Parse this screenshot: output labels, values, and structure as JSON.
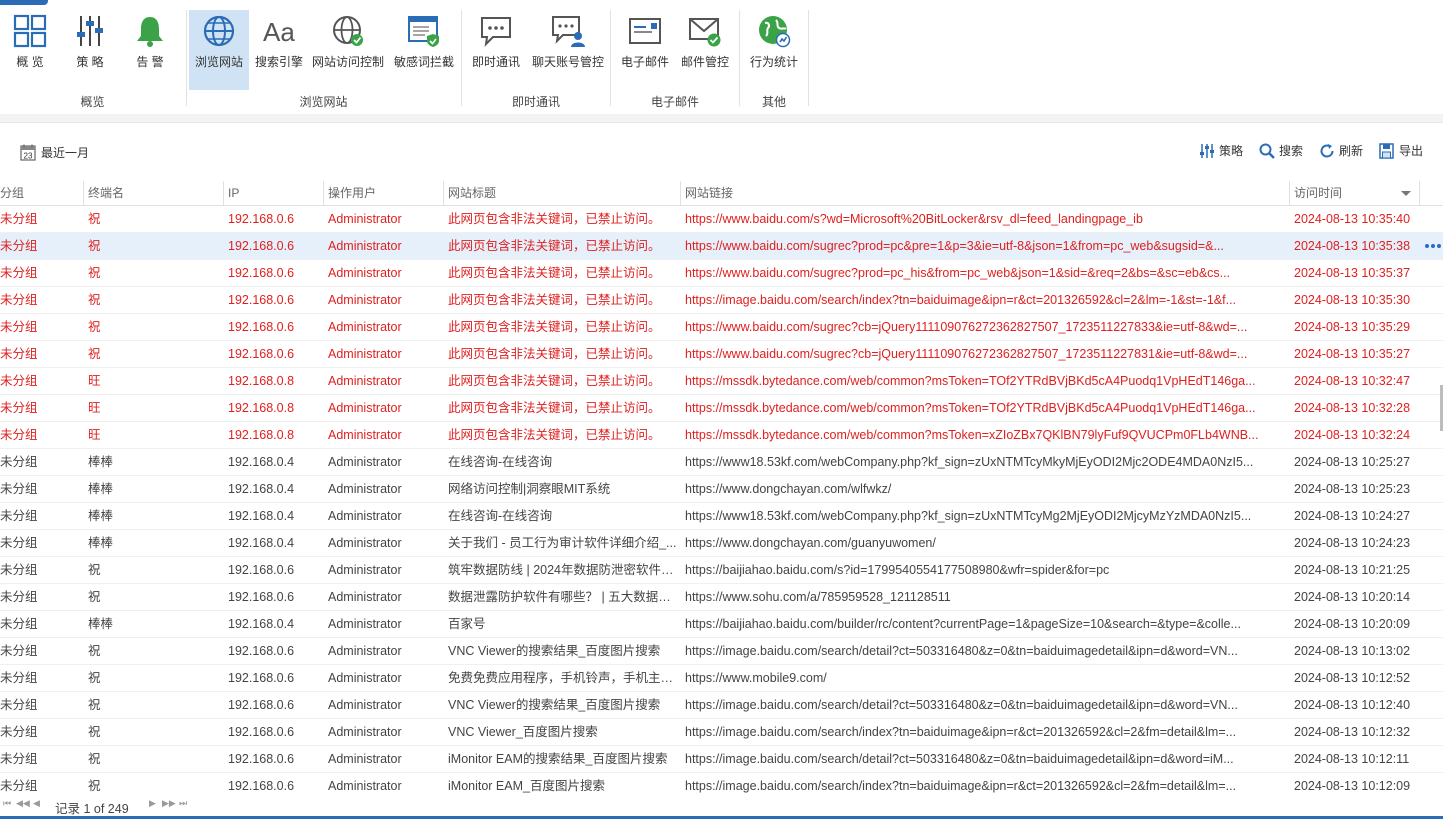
{
  "ribbon": {
    "groups": [
      {
        "label": "概览",
        "buttons": [
          {
            "label": "概 览",
            "icon": "overview-grid-icon"
          },
          {
            "label": "策 略",
            "icon": "strategy-sliders-icon"
          },
          {
            "label": "告 警",
            "icon": "alarm-bell-icon"
          }
        ]
      },
      {
        "label": "浏览网站",
        "buttons": [
          {
            "label": "浏览网站",
            "icon": "globe-icon",
            "active": true
          },
          {
            "label": "搜索引擎",
            "icon": "font-aa-icon"
          },
          {
            "label": "网站访问控制",
            "icon": "globe-lock-icon"
          },
          {
            "label": "敏感词拦截",
            "icon": "window-shield-icon"
          }
        ]
      },
      {
        "label": "即时通讯",
        "buttons": [
          {
            "label": "即时通讯",
            "icon": "chat-bubble-icon"
          },
          {
            "label": "聊天账号管控",
            "icon": "chat-user-icon"
          }
        ]
      },
      {
        "label": "电子邮件",
        "buttons": [
          {
            "label": "电子邮件",
            "icon": "email-window-icon"
          },
          {
            "label": "邮件管控",
            "icon": "envelope-check-icon"
          }
        ]
      },
      {
        "label": "其他",
        "buttons": [
          {
            "label": "行为统计",
            "icon": "stats-globe-icon"
          }
        ]
      }
    ]
  },
  "toolbar": {
    "period_label": "最近一月",
    "calendar_day": "23",
    "actions": [
      {
        "label": "策略",
        "icon": "sliders-icon"
      },
      {
        "label": "搜索",
        "icon": "search-icon"
      },
      {
        "label": "刷新",
        "icon": "refresh-icon"
      },
      {
        "label": "导出",
        "icon": "export-icon"
      }
    ]
  },
  "grid": {
    "columns": [
      "分组",
      "终端名",
      "IP",
      "操作用户",
      "网站标题",
      "网站链接",
      "访问时间"
    ],
    "rows": [
      {
        "group": "未分组",
        "terminal": "祝",
        "ip": "192.168.0.6",
        "user": "Administrator",
        "title": "此网页包含非法关键词，已禁止访问。",
        "url": "https://www.baidu.com/s?wd=Microsoft%20BitLocker&rsv_dl=feed_landingpage_ib",
        "time": "2024-08-13 10:35:40",
        "alert": true
      },
      {
        "group": "未分组",
        "terminal": "祝",
        "ip": "192.168.0.6",
        "user": "Administrator",
        "title": "此网页包含非法关键词，已禁止访问。",
        "url": "https://www.baidu.com/sugrec?prod=pc&pre=1&p=3&ie=utf-8&json=1&from=pc_web&sugsid=&...",
        "time": "2024-08-13 10:35:38",
        "alert": true,
        "selected": true
      },
      {
        "group": "未分组",
        "terminal": "祝",
        "ip": "192.168.0.6",
        "user": "Administrator",
        "title": "此网页包含非法关键词，已禁止访问。",
        "url": "https://www.baidu.com/sugrec?prod=pc_his&from=pc_web&json=1&sid=&req=2&bs=&sc=eb&cs...",
        "time": "2024-08-13 10:35:37",
        "alert": true
      },
      {
        "group": "未分组",
        "terminal": "祝",
        "ip": "192.168.0.6",
        "user": "Administrator",
        "title": "此网页包含非法关键词，已禁止访问。",
        "url": "https://image.baidu.com/search/index?tn=baiduimage&ipn=r&ct=201326592&cl=2&lm=-1&st=-1&f...",
        "time": "2024-08-13 10:35:30",
        "alert": true
      },
      {
        "group": "未分组",
        "terminal": "祝",
        "ip": "192.168.0.6",
        "user": "Administrator",
        "title": "此网页包含非法关键词，已禁止访问。",
        "url": "https://www.baidu.com/sugrec?cb=jQuery111109076272362827507_1723511227833&ie=utf-8&wd=...",
        "time": "2024-08-13 10:35:29",
        "alert": true
      },
      {
        "group": "未分组",
        "terminal": "祝",
        "ip": "192.168.0.6",
        "user": "Administrator",
        "title": "此网页包含非法关键词，已禁止访问。",
        "url": "https://www.baidu.com/sugrec?cb=jQuery111109076272362827507_1723511227831&ie=utf-8&wd=...",
        "time": "2024-08-13 10:35:27",
        "alert": true
      },
      {
        "group": "未分组",
        "terminal": "旺",
        "ip": "192.168.0.8",
        "user": "Administrator",
        "title": "此网页包含非法关键词，已禁止访问。",
        "url": "https://mssdk.bytedance.com/web/common?msToken=TOf2YTRdBVjBKd5cA4Puodq1VpHEdT146ga...",
        "time": "2024-08-13 10:32:47",
        "alert": true
      },
      {
        "group": "未分组",
        "terminal": "旺",
        "ip": "192.168.0.8",
        "user": "Administrator",
        "title": "此网页包含非法关键词，已禁止访问。",
        "url": "https://mssdk.bytedance.com/web/common?msToken=TOf2YTRdBVjBKd5cA4Puodq1VpHEdT146ga...",
        "time": "2024-08-13 10:32:28",
        "alert": true
      },
      {
        "group": "未分组",
        "terminal": "旺",
        "ip": "192.168.0.8",
        "user": "Administrator",
        "title": "此网页包含非法关键词，已禁止访问。",
        "url": "https://mssdk.bytedance.com/web/common?msToken=xZIoZBx7QKlBN79lyFuf9QVUCPm0FLb4WNB...",
        "time": "2024-08-13 10:32:24",
        "alert": true
      },
      {
        "group": "未分组",
        "terminal": "棒棒",
        "ip": "192.168.0.4",
        "user": "Administrator",
        "title": "在线咨询-在线咨询",
        "url": "https://www18.53kf.com/webCompany.php?kf_sign=zUxNTMTcyMkyMjEyODI2Mjc2ODE4MDA0NzI5...",
        "time": "2024-08-13 10:25:27"
      },
      {
        "group": "未分组",
        "terminal": "棒棒",
        "ip": "192.168.0.4",
        "user": "Administrator",
        "title": "网络访问控制|洞察眼MIT系统",
        "url": "https://www.dongchayan.com/wlfwkz/",
        "time": "2024-08-13 10:25:23"
      },
      {
        "group": "未分组",
        "terminal": "棒棒",
        "ip": "192.168.0.4",
        "user": "Administrator",
        "title": "在线咨询-在线咨询",
        "url": "https://www18.53kf.com/webCompany.php?kf_sign=zUxNTMTcyMg2MjEyODI2MjcyMzYzMDA0NzI5...",
        "time": "2024-08-13 10:24:27"
      },
      {
        "group": "未分组",
        "terminal": "棒棒",
        "ip": "192.168.0.4",
        "user": "Administrator",
        "title": "关于我们 - 员工行为审计软件详细介绍_...",
        "url": "https://www.dongchayan.com/guanyuwomen/",
        "time": "2024-08-13 10:24:23"
      },
      {
        "group": "未分组",
        "terminal": "祝",
        "ip": "192.168.0.6",
        "user": "Administrator",
        "title": "筑牢数据防线 | 2024年数据防泄密软件精...",
        "url": "https://baijiahao.baidu.com/s?id=1799540554177508980&wfr=spider&for=pc",
        "time": "2024-08-13 10:21:25"
      },
      {
        "group": "未分组",
        "terminal": "祝",
        "ip": "192.168.0.6",
        "user": "Administrator",
        "title": "数据泄露防护软件有哪些？ | 五大数据防...",
        "url": "https://www.sohu.com/a/785959528_121128511",
        "time": "2024-08-13 10:20:14"
      },
      {
        "group": "未分组",
        "terminal": "棒棒",
        "ip": "192.168.0.4",
        "user": "Administrator",
        "title": "百家号",
        "url": "https://baijiahao.baidu.com/builder/rc/content?currentPage=1&pageSize=10&search=&type=&colle...",
        "time": "2024-08-13 10:20:09"
      },
      {
        "group": "未分组",
        "terminal": "祝",
        "ip": "192.168.0.6",
        "user": "Administrator",
        "title": "VNC Viewer的搜索结果_百度图片搜索",
        "url": "https://image.baidu.com/search/detail?ct=503316480&z=0&tn=baiduimagedetail&ipn=d&word=VN...",
        "time": "2024-08-13 10:13:02"
      },
      {
        "group": "未分组",
        "terminal": "祝",
        "ip": "192.168.0.6",
        "user": "Administrator",
        "title": "免费免费应用程序，手机铃声，手机主题...",
        "url": "https://www.mobile9.com/",
        "time": "2024-08-13 10:12:52"
      },
      {
        "group": "未分组",
        "terminal": "祝",
        "ip": "192.168.0.6",
        "user": "Administrator",
        "title": "VNC Viewer的搜索结果_百度图片搜索",
        "url": "https://image.baidu.com/search/detail?ct=503316480&z=0&tn=baiduimagedetail&ipn=d&word=VN...",
        "time": "2024-08-13 10:12:40"
      },
      {
        "group": "未分组",
        "terminal": "祝",
        "ip": "192.168.0.6",
        "user": "Administrator",
        "title": "VNC Viewer_百度图片搜索",
        "url": "https://image.baidu.com/search/index?tn=baiduimage&ipn=r&ct=201326592&cl=2&fm=detail&lm=...",
        "time": "2024-08-13 10:12:32"
      },
      {
        "group": "未分组",
        "terminal": "祝",
        "ip": "192.168.0.6",
        "user": "Administrator",
        "title": "iMonitor EAM的搜索结果_百度图片搜索",
        "url": "https://image.baidu.com/search/detail?ct=503316480&z=0&tn=baiduimagedetail&ipn=d&word=iM...",
        "time": "2024-08-13 10:12:11"
      },
      {
        "group": "未分组",
        "terminal": "祝",
        "ip": "192.168.0.6",
        "user": "Administrator",
        "title": "iMonitor EAM_百度图片搜索",
        "url": "https://image.baidu.com/search/index?tn=baiduimage&ipn=r&ct=201326592&cl=2&fm=detail&lm=...",
        "time": "2024-08-13 10:12:09"
      }
    ]
  },
  "pager": {
    "text": "记录 1 of 249"
  },
  "colors": {
    "accent": "#2b6cb7",
    "alert": "#e02020",
    "selected_row": "#e6f0fa",
    "active_button": "#cfe3f4"
  }
}
